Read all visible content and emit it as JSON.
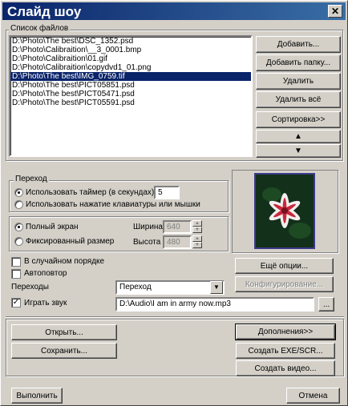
{
  "window": {
    "title": "Слайд шоу",
    "close_glyph": "✕"
  },
  "files": {
    "group_label": "Список файлов",
    "items": [
      "D:\\Photo\\The best\\DSC_1352.psd",
      "D:\\Photo\\Calibraition\\__3_0001.bmp",
      "D:\\Photo\\Calibraition\\01.gif",
      "D:\\Photo\\Calibraition\\copydvd1_01.png",
      "D:\\Photo\\The best\\IMG_0759.tif",
      "D:\\Photo\\The best\\PICT05851.psd",
      "D:\\Photo\\The best\\PICT05471.psd",
      "D:\\Photo\\The best\\PICT05591.psd"
    ],
    "selected_index": 4,
    "buttons": {
      "add": "Добавить...",
      "add_folder": "Добавить папку...",
      "delete": "Удалить",
      "delete_all": "Удалить всё",
      "sort": "Сортировка>>",
      "up": "▲",
      "down": "▼"
    }
  },
  "transition": {
    "group_label": "Переход",
    "use_timer": "Использовать таймер (в секундах)",
    "timer_value": "5",
    "use_keys": "Использовать нажатие клавиатуры или мышки"
  },
  "screen": {
    "full": "Полный экран",
    "fixed": "Фиксированный размер",
    "width_label": "Ширина",
    "width_value": "640",
    "height_label": "Высота",
    "height_value": "480"
  },
  "options": {
    "random": "В случайном порядке",
    "repeat": "Автоповтор",
    "transitions_label": "Переходы",
    "transitions_value": "Переход",
    "play_sound": "Играть звук",
    "sound_path": "D:\\Audio\\I am in army now.mp3",
    "browse": "...",
    "more_options": "Ещё опции...",
    "configure": "Конфигурирование..."
  },
  "bottom": {
    "open": "Открыть...",
    "save": "Сохранить...",
    "extras": "Дополнения>>",
    "create_exe": "Создать EXE/SCR...",
    "create_video": "Создать видео...",
    "run": "Выполнить",
    "cancel": "Отмена"
  },
  "colors": {
    "title_bar": "#0a246a",
    "selection": "#0a246a",
    "face": "#d4d0c8"
  }
}
